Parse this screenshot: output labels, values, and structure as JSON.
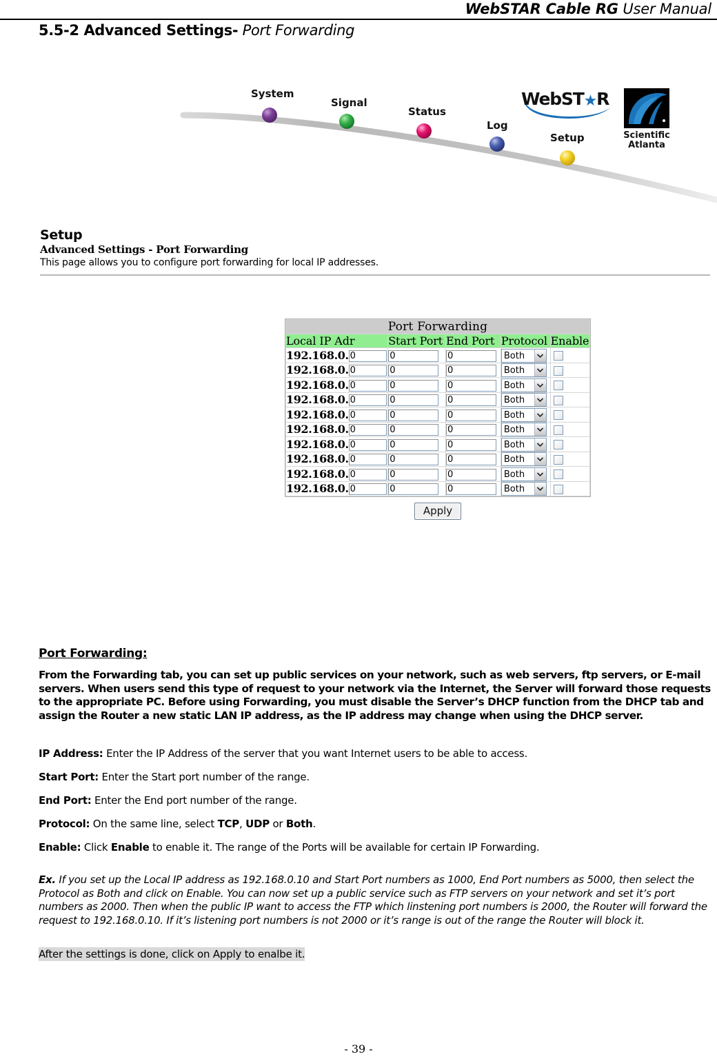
{
  "header": {
    "manual_title_italic": "WebSTAR Cable RG",
    "manual_title_rest": " User Manual"
  },
  "section": {
    "number_title": "5.5-2 Advanced Settings-",
    "subtitle": " Port Forwarding"
  },
  "nav": {
    "items": [
      {
        "label": "System",
        "color": "#7b3f98"
      },
      {
        "label": "Signal",
        "color": "#36b24a"
      },
      {
        "label": "Status",
        "color": "#e6146e"
      },
      {
        "label": "Log",
        "color": "#4a5fb0"
      },
      {
        "label": "Setup",
        "color": "#f2d024"
      }
    ]
  },
  "brand": {
    "webstar_part1": "WebST",
    "webstar_star": "★",
    "webstar_part2": "R",
    "sa_line1": "Scientific",
    "sa_line2": "Atlanta"
  },
  "setup_panel": {
    "title": "Setup",
    "subtitle": "Advanced Settings - Port Forwarding",
    "description": "This page allows you to configure port forwarding for local IP addresses."
  },
  "pf_table": {
    "caption": "Port Forwarding",
    "columns": [
      "Local IP Adr",
      "Start Port",
      "End Port",
      "Protocol",
      "Enable"
    ],
    "ip_prefix": "192.168.0.",
    "rows": [
      {
        "octet": "0",
        "start_port": "0",
        "end_port": "0",
        "protocol": "Both",
        "enabled": false
      },
      {
        "octet": "0",
        "start_port": "0",
        "end_port": "0",
        "protocol": "Both",
        "enabled": false
      },
      {
        "octet": "0",
        "start_port": "0",
        "end_port": "0",
        "protocol": "Both",
        "enabled": false
      },
      {
        "octet": "0",
        "start_port": "0",
        "end_port": "0",
        "protocol": "Both",
        "enabled": false
      },
      {
        "octet": "0",
        "start_port": "0",
        "end_port": "0",
        "protocol": "Both",
        "enabled": false
      },
      {
        "octet": "0",
        "start_port": "0",
        "end_port": "0",
        "protocol": "Both",
        "enabled": false
      },
      {
        "octet": "0",
        "start_port": "0",
        "end_port": "0",
        "protocol": "Both",
        "enabled": false
      },
      {
        "octet": "0",
        "start_port": "0",
        "end_port": "0",
        "protocol": "Both",
        "enabled": false
      },
      {
        "octet": "0",
        "start_port": "0",
        "end_port": "0",
        "protocol": "Both",
        "enabled": false
      },
      {
        "octet": "0",
        "start_port": "0",
        "end_port": "0",
        "protocol": "Both",
        "enabled": false
      }
    ],
    "protocol_options": [
      "TCP",
      "UDP",
      "Both"
    ],
    "apply_label": "Apply"
  },
  "content": {
    "heading": "Port Forwarding:",
    "intro": "From the Forwarding tab, you can set up public services on your network, such as web servers, ftp servers, or E-mail servers. When users send this type of request to your network via the Internet, the Server will forward those requests to the appropriate PC. Before using Forwarding, you must disable the Server’s DHCP function from the DHCP tab and assign the Router a new static LAN IP address, as the IP address may change when using the DHCP server.",
    "definitions": [
      {
        "term": "IP Address:",
        "text": " Enter the IP Address of the server that you want Internet users to be able to access."
      },
      {
        "term": "Start Port:",
        "text": "   Enter the Start port number of the range."
      },
      {
        "term": "End Port:",
        "text": "   Enter the End port number of the range."
      },
      {
        "term": "Protocol:",
        "text_pre": "   On the same line, select ",
        "bold1": "TCP",
        "mid1": ", ",
        "bold2": "UDP",
        "mid2": " or ",
        "bold3": "Both",
        "text_post": "."
      },
      {
        "term": "Enable:",
        "text_pre": " Click ",
        "bold1": "Enable",
        "text_post": " to enable it. The range of the Ports will be available for certain IP Forwarding."
      }
    ],
    "example_tag": "Ex.",
    "example_text": " If you set up the Local IP address as 192.168.0.10 and Start Port numbers as 1000, End Port numbers as 5000, then select the Protocol as Both and click on Enable. You can now set up a public service such as FTP servers on your network and set it’s port numbers as 2000. Then when the public IP want to access the FTP which linstening port numbers is 2000, the Router will forward the request to 192.168.0.10. If it’s listening port numbers is not 2000 or it’s range is out of the range the Router will block it.",
    "final_note": "After the settings is done, click on Apply to enalbe it."
  },
  "footer": {
    "page_number": "- 39 -"
  },
  "colors": {
    "table_header_green": "#90ee90",
    "table_caption_gray": "#cccccc",
    "highlight_gray": "#d9d9d9"
  }
}
